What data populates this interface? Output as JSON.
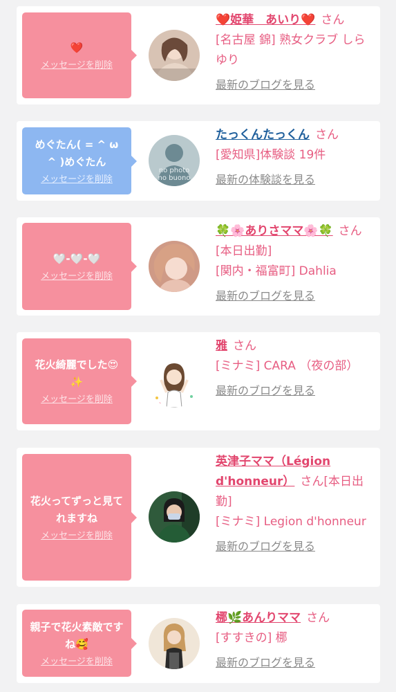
{
  "delete_label": "メッセージを削除",
  "honorific": "さん",
  "colors": {
    "pink": "#f6909e",
    "blue": "#8db7f1",
    "name": "#e2466e",
    "name_blue": "#1f5f9c"
  },
  "items": [
    {
      "message": "❤️",
      "name": "❤️姫華　あいり❤️",
      "name_trail": "",
      "details": [
        "[名古屋 錦] 熟女クラブ しらゆり"
      ],
      "link": "最新のブログを見る",
      "avatar_icon": "photo-avatar"
    },
    {
      "message": "めぐたん( = ^ ω ^ )めぐたん",
      "name": "たっくんたっくん",
      "name_trail": "",
      "details": [
        "[愛知県]体験談 19件"
      ],
      "link": "最新の体験談を見る",
      "avatar_text": [
        "no photo",
        "no buono"
      ]
    },
    {
      "message": "🤍-🤍-🤍",
      "name": "🍀🌸ありさママ🌸🍀",
      "name_trail": "[本日出勤]",
      "details": [
        "[関内・福富町] Dahlia"
      ],
      "link": "最新のブログを見る"
    },
    {
      "message": "花火綺麗でした😍✨",
      "name": "雅",
      "name_trail": "",
      "details": [
        "[ミナミ] CARA （夜の部）"
      ],
      "link": "最新のブログを見る"
    },
    {
      "message": "花火ってずっと見てれますね",
      "name": "英津子ママ（Légion d'honneur）",
      "name_trail": "[本日出勤]",
      "details": [
        "[ミナミ] Legion d'honneur"
      ],
      "link": "最新のブログを見る"
    },
    {
      "message": "親子で花火素敵ですね🥰",
      "name": "梛🌿あんりママ",
      "name_trail": "",
      "details": [
        "[すすきの] 梛"
      ],
      "link": "最新のブログを見る"
    }
  ]
}
